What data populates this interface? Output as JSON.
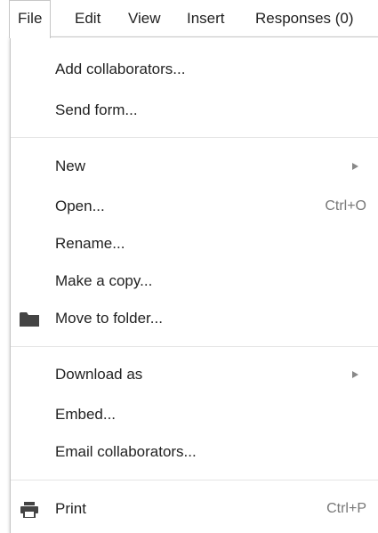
{
  "menubar": {
    "items": [
      {
        "label": "File"
      },
      {
        "label": "Edit"
      },
      {
        "label": "View"
      },
      {
        "label": "Insert"
      },
      {
        "label": "Responses (0)"
      }
    ]
  },
  "file_menu": {
    "add_collaborators": "Add collaborators...",
    "send_form": "Send form...",
    "new": "New",
    "open": "Open...",
    "open_shortcut": "Ctrl+O",
    "rename": "Rename...",
    "make_copy": "Make a copy...",
    "move_to_folder": "Move to folder...",
    "download_as": "Download as",
    "embed": "Embed...",
    "email_collaborators": "Email collaborators...",
    "print": "Print",
    "print_shortcut": "Ctrl+P"
  },
  "icons": {
    "folder": "folder-icon",
    "printer": "printer-icon",
    "submenu_arrow": "chevron-right-icon"
  },
  "colors": {
    "menu_text": "#222222",
    "shortcut_text": "#777777",
    "border": "#c6c6c6",
    "icon": "#444444"
  }
}
